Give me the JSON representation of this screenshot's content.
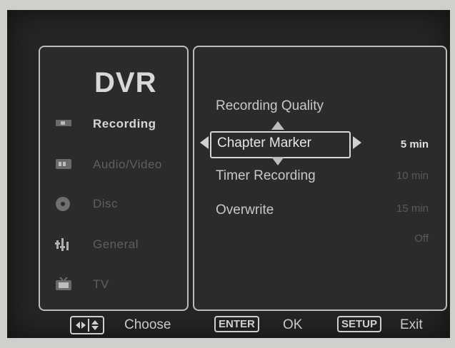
{
  "osd_title": "DVR",
  "sidebar": {
    "items": [
      {
        "label": "Recording",
        "icon": "recording-icon"
      },
      {
        "label": "Audio/Video",
        "icon": "audio-video-icon"
      },
      {
        "label": "Disc",
        "icon": "disc-icon"
      },
      {
        "label": "General",
        "icon": "general-icon"
      },
      {
        "label": "TV",
        "icon": "tv-icon"
      }
    ],
    "active_index": 0
  },
  "menu": {
    "items": [
      {
        "label": "Recording Quality"
      },
      {
        "label": "Chapter Marker"
      },
      {
        "label": "Timer Recording"
      },
      {
        "label": "Overwrite"
      }
    ],
    "selected_index": 1,
    "values": [
      "5 min",
      "10 min",
      "15 min",
      "Off"
    ],
    "selected_value_index": 0
  },
  "footer": {
    "choose_label": "Choose",
    "enter_key": "ENTER",
    "ok_label": "OK",
    "setup_key": "SETUP",
    "exit_label": "Exit"
  },
  "colors": {
    "screen_bg": "#252525",
    "panel_border": "#bdbdbd",
    "text_active": "#d6d6d6",
    "text_inactive": "#5f5f5f"
  }
}
